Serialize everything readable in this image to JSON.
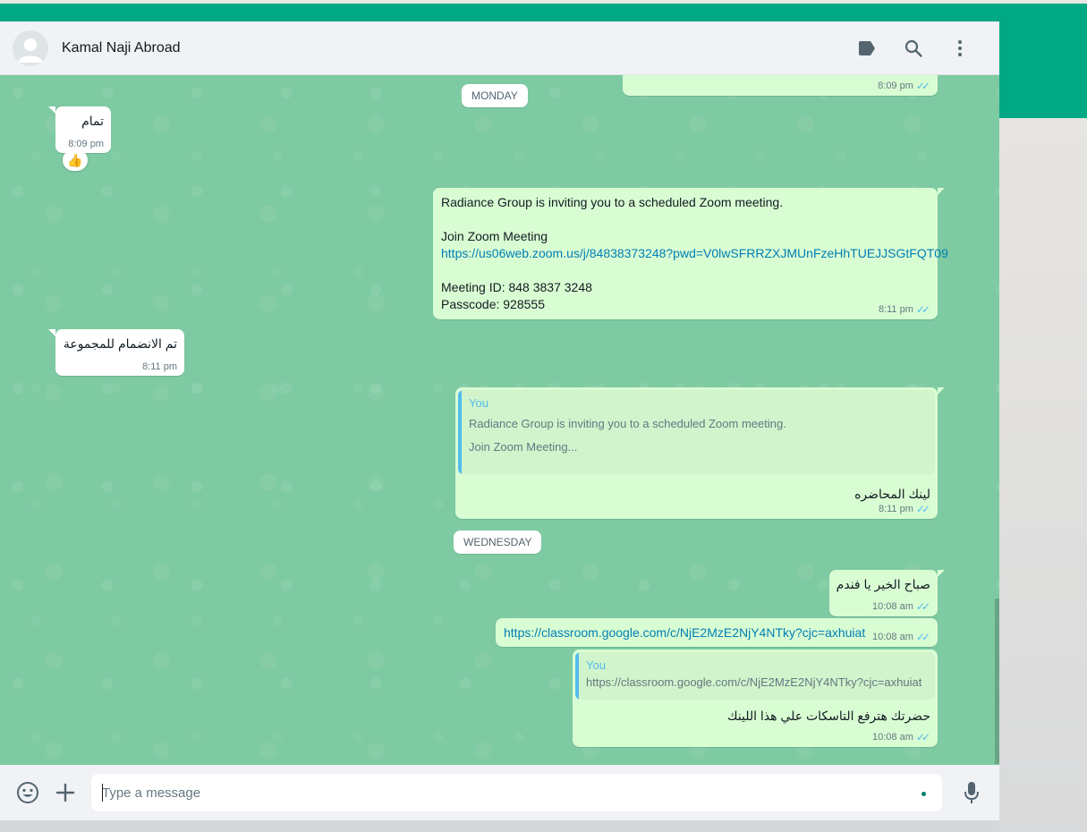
{
  "header": {
    "contact_name": "Kamal Naji Abroad"
  },
  "icons": {
    "avatar": "default-avatar-icon",
    "label": "label-icon",
    "search": "search-icon",
    "menu": "more-vertical-icon",
    "emoji": "emoji-icon",
    "attach": "plus-icon",
    "mic": "microphone-icon"
  },
  "colors": {
    "accent": "#00a884",
    "outgoing_bubble": "#d9fdd3",
    "incoming_bubble": "#ffffff",
    "link": "#027eb5",
    "read_ticks": "#53bdeb",
    "chat_background": "#7ecaa2"
  },
  "chat": {
    "prev_message": {
      "time": "8:09 pm"
    },
    "day_monday": "MONDAY",
    "msg_in_1": {
      "text": "تمام",
      "time": "8:09 pm",
      "reaction": "👍"
    },
    "msg_zoom": {
      "line1": "Radiance Group is inviting you to a scheduled Zoom meeting.",
      "line2": "Join Zoom Meeting",
      "link": "https://us06web.zoom.us/j/84838373248?pwd=V0lwSFRRZXJMUnFzeHhTUEJJSGtFQT09",
      "line3": "Meeting ID: 848 3837 3248",
      "line4": "Passcode: 928555",
      "time": "8:11 pm"
    },
    "msg_in_2": {
      "text": "تم الانضمام للمجموعة",
      "time": "8:11 pm"
    },
    "msg_reply_1": {
      "quote_author": "You",
      "quote_line1": "Radiance Group is inviting you to a scheduled Zoom meeting.",
      "quote_line2": "Join Zoom Meeting...",
      "text": "لينك المحاضره",
      "time": "8:11 pm"
    },
    "day_wednesday": "WEDNESDAY",
    "msg_out_1": {
      "text": "صباح الخير يا فندم",
      "time": "10:08 am"
    },
    "msg_link": {
      "link": "https://classroom.google.com/c/NjE2MzE2NjY4NTky?cjc=axhuiat",
      "time": "10:08 am"
    },
    "msg_reply_2": {
      "quote_author": "You",
      "quote_text": "https://classroom.google.com/c/NjE2MzE2NjY4NTky?cjc=axhuiat",
      "text": "حضرتك هترفع التاسكات علي هذا اللينك",
      "time": "10:08 am"
    }
  },
  "composer": {
    "placeholder": "Type a message",
    "value": ""
  }
}
